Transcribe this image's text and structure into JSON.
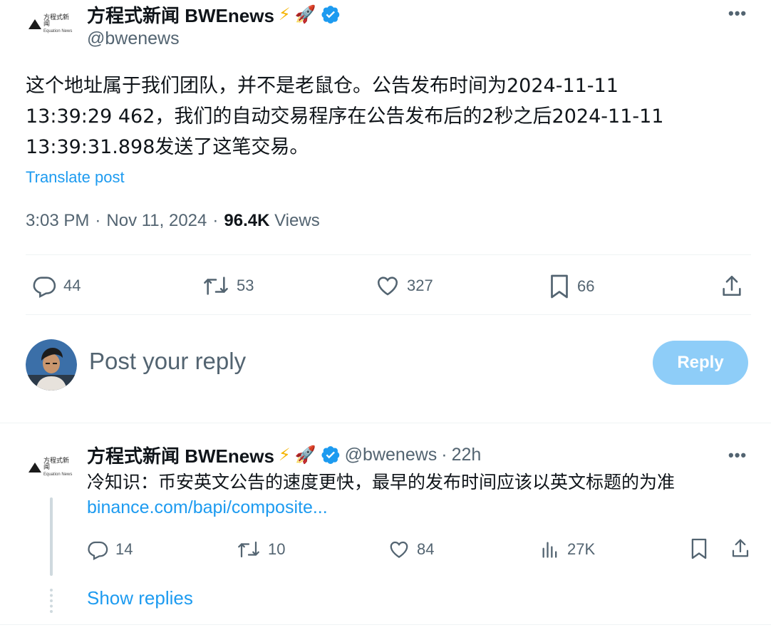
{
  "main_post": {
    "logo_cn": "方程式新闻",
    "logo_en": "Equation News",
    "display_name": "方程式新闻 BWEnews",
    "emoji_bolt": "⚡",
    "emoji_rocket": "🚀",
    "handle": "@bwenews",
    "text_line1": "这个地址属于我们团队，并不是老鼠仓。公告发布时间为2024-11-11",
    "text_line2": "13:39:29 462，我们的自动交易程序在公告发布后的2秒之后2024-11-11",
    "text_line3": "13:39:31.898发送了这笔交易。",
    "translate_label": "Translate post",
    "time": "3:03 PM",
    "date": "Nov 11, 2024",
    "sep": "·",
    "views_count": "96.4K",
    "views_label": "Views",
    "replies": "44",
    "reposts": "53",
    "likes": "327",
    "bookmarks": "66"
  },
  "composer": {
    "placeholder": "Post your reply",
    "reply_button": "Reply"
  },
  "reply_post": {
    "logo_cn": "方程式新闻",
    "logo_en": "Equation News",
    "display_name": "方程式新闻 BWEnews",
    "emoji_bolt": "⚡",
    "emoji_rocket": "🚀",
    "handle": "@bwenews",
    "sep": "·",
    "age": "22h",
    "text": "冷知识：币安英文公告的速度更快，最早的发布时间应该以英文标题的为准",
    "link": "binance.com/bapi/composite...",
    "replies": "14",
    "reposts": "10",
    "likes": "84",
    "views": "27K",
    "show_replies": "Show replies"
  },
  "colors": {
    "accent": "#1d9bf0",
    "muted": "#536471",
    "reply_button_bg": "#8ecdf8"
  }
}
